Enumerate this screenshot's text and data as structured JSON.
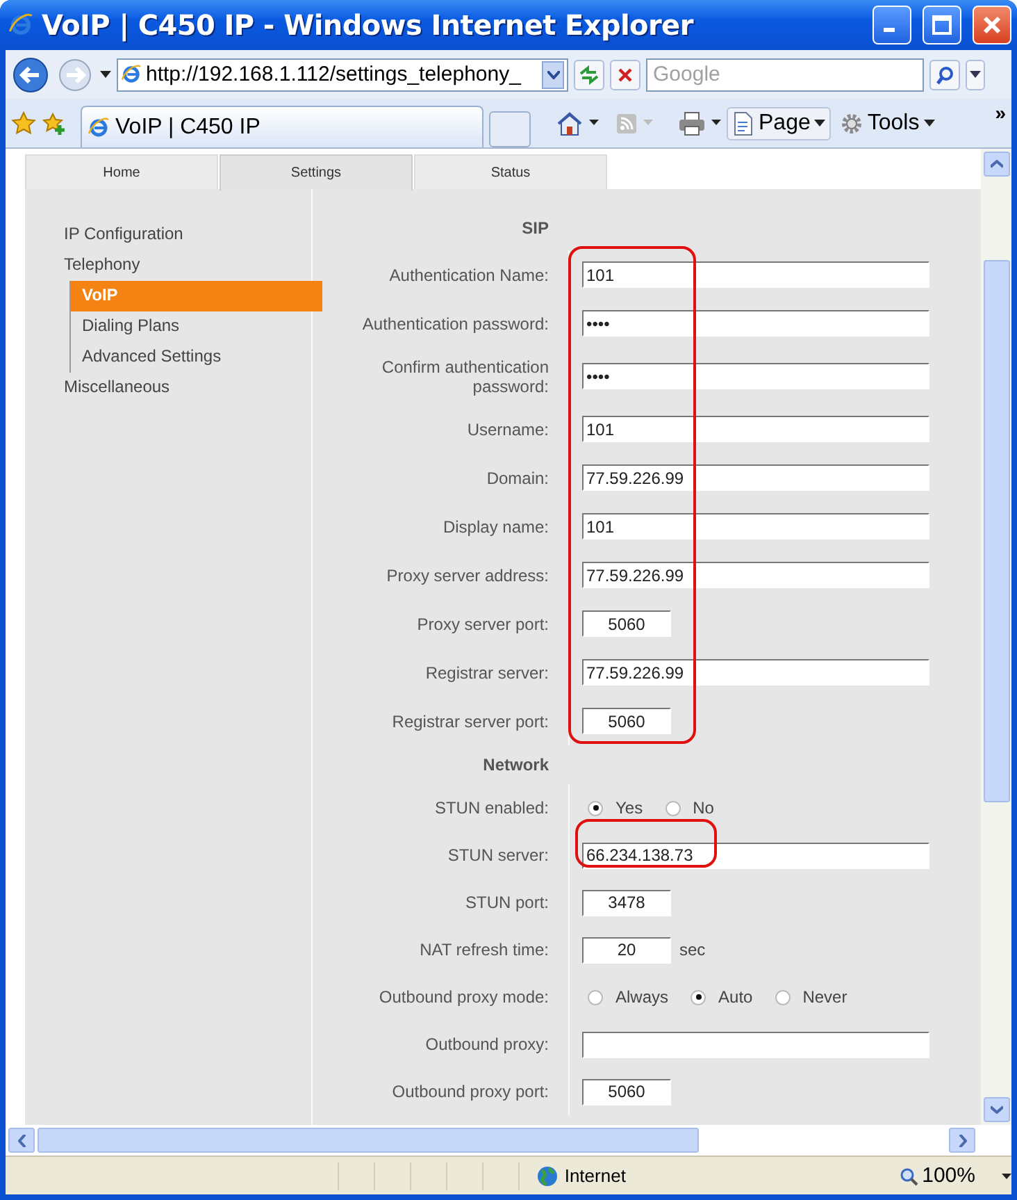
{
  "window": {
    "title": "VoIP | C450 IP - Windows Internet Explorer"
  },
  "toolbar": {
    "address": "http://192.168.1.112/settings_telephony_",
    "search_placeholder": "Google"
  },
  "favorites_bar": {
    "tab_title": "VoIP | C450 IP",
    "page_menu": "Page",
    "tools_menu": "Tools",
    "more": "»"
  },
  "page": {
    "tabs": [
      {
        "label": "Home",
        "selected": false
      },
      {
        "label": "Settings",
        "selected": true
      },
      {
        "label": "Status",
        "selected": false
      }
    ],
    "nav": [
      {
        "label": "IP Configuration",
        "selected": false
      },
      {
        "label": "Telephony",
        "selected": false,
        "children": [
          {
            "label": "VoIP",
            "selected": true
          },
          {
            "label": "Dialing Plans",
            "selected": false
          },
          {
            "label": "Advanced Settings",
            "selected": false
          }
        ]
      },
      {
        "label": "Miscellaneous",
        "selected": false
      }
    ],
    "sections": [
      {
        "title": "SIP",
        "circled": true,
        "rows": [
          {
            "label": "Authentication Name:",
            "kind": "text",
            "value": "101"
          },
          {
            "label": "Authentication password:",
            "kind": "text",
            "value": "••••"
          },
          {
            "label": "Confirm authentication password:",
            "kind": "text",
            "value": "••••"
          },
          {
            "label": "Username:",
            "kind": "text",
            "value": "101"
          },
          {
            "label": "Domain:",
            "kind": "text",
            "value": "77.59.226.99"
          },
          {
            "label": "Display name:",
            "kind": "text",
            "value": "101"
          },
          {
            "label": "Proxy server address:",
            "kind": "text",
            "value": "77.59.226.99"
          },
          {
            "label": "Proxy server port:",
            "kind": "short",
            "value": "5060"
          },
          {
            "label": "Registrar server:",
            "kind": "text",
            "value": "77.59.226.99"
          },
          {
            "label": "Registrar server port:",
            "kind": "short",
            "value": "5060"
          }
        ]
      },
      {
        "title": "Network",
        "circled": false,
        "rows": [
          {
            "label": "STUN enabled:",
            "kind": "radio",
            "options": [
              {
                "label": "Yes",
                "selected": true
              },
              {
                "label": "No",
                "selected": false
              }
            ]
          },
          {
            "label": "STUN server:",
            "kind": "text",
            "value": "66.234.138.73",
            "circled": true
          },
          {
            "label": "STUN port:",
            "kind": "short",
            "value": "3478"
          },
          {
            "label": "NAT refresh time:",
            "kind": "short",
            "value": "20",
            "unit": "sec"
          },
          {
            "label": "Outbound proxy mode:",
            "kind": "radio",
            "options": [
              {
                "label": "Always",
                "selected": false
              },
              {
                "label": "Auto",
                "selected": true
              },
              {
                "label": "Never",
                "selected": false
              }
            ]
          },
          {
            "label": "Outbound proxy:",
            "kind": "text",
            "value": ""
          },
          {
            "label": "Outbound proxy port:",
            "kind": "short",
            "value": "5060"
          }
        ]
      }
    ]
  },
  "status_bar": {
    "zone": "Internet",
    "zoom": "100%"
  }
}
